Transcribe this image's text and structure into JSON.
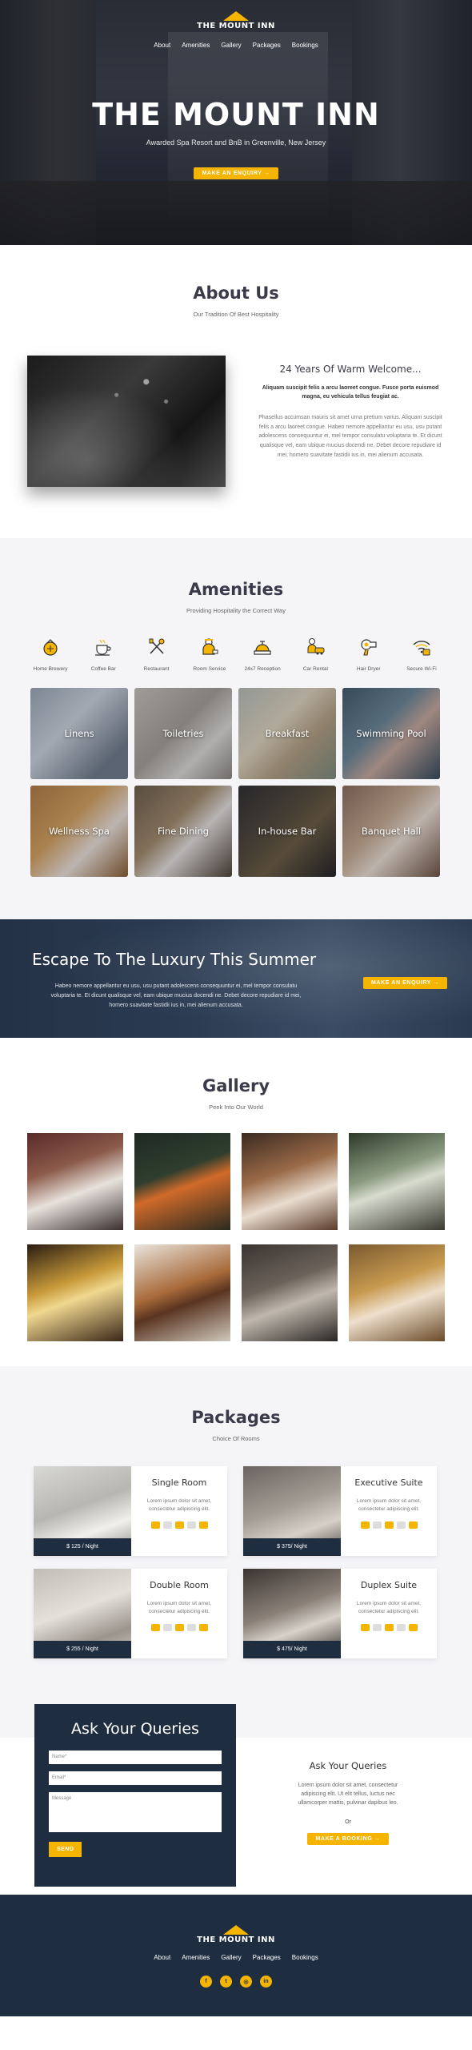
{
  "brand": {
    "name": "THE MOUNT INN"
  },
  "nav": [
    "About",
    "Amenities",
    "Gallery",
    "Packages",
    "Bookings"
  ],
  "hero": {
    "title": "THE MOUNT INN",
    "subtitle": "Awarded Spa Resort and BnB in Greenville, New Jersey",
    "cta": "MAKE AN ENQUIRY →"
  },
  "about": {
    "title": "About Us",
    "subtitle": "Our Tradition Of Best Hospitality",
    "heading": "24 Years Of Warm Welcome...",
    "lead": "Aliquam suscipit felis a arcu laoreet congue. Fusce porta euismod magna, eu vehicula tellus feugiat ac.",
    "body": "Phasellus accumsan mauris sit amet urna pretium varius. Aliquam suscipit felis a arcu laoreet congue. Habeo nemore appellantur eu usu, usu putant adolescens consequuntur ei, mel tempor consulatu voluptaria te. Et dicunt qualisque vel, eam ubique mucius docendi ne. Debet decore repudiare id mei, homero suavitate fastidii ius in, mei alienum accusata."
  },
  "amenities": {
    "title": "Amenities",
    "subtitle": "Providing Hospitality the Correct Way",
    "icons": [
      {
        "label": "Home Brewery",
        "icon": "brewery-icon"
      },
      {
        "label": "Coffee Bar",
        "icon": "coffee-icon"
      },
      {
        "label": "Restaurant",
        "icon": "restaurant-icon"
      },
      {
        "label": "Room Service",
        "icon": "room-service-icon"
      },
      {
        "label": "24x7 Reception",
        "icon": "reception-bell-icon"
      },
      {
        "label": "Car Rental",
        "icon": "car-icon"
      },
      {
        "label": "Hair Dryer",
        "icon": "hair-dryer-icon"
      },
      {
        "label": "Secure Wi-Fi",
        "icon": "wifi-icon"
      }
    ],
    "tiles": [
      "Linens",
      "Toiletries",
      "Breakfast",
      "Swimming Pool",
      "Wellness Spa",
      "Fine Dining",
      "In-house Bar",
      "Banquet Hall"
    ]
  },
  "escape": {
    "title": "Escape To The Luxury This Summer",
    "body": "Habeo nemore appellantur eu usu, usu putant adolescens consequuntur ei, mel tempor consulatu voluptaria te. Et dicunt qualisque vel, eam ubique mucius docendi ne. Debet decore repudiare id mei, homero suavitate fastidii ius in, mei alienum accusata.",
    "cta": "MAKE AN ENQUIRY →"
  },
  "gallery": {
    "title": "Gallery",
    "subtitle": "Peek Into Our World"
  },
  "packages": {
    "title": "Packages",
    "subtitle": "Choice Of Rooms",
    "items": [
      {
        "name": "Single Room",
        "desc": "Lorem ipsum dolor sit amet, consectetur adipiscing elit.",
        "price": "$ 125 / Night"
      },
      {
        "name": "Executive Suite",
        "desc": "Lorem ipsum dolor sit amet, consectetur adipiscing elit.",
        "price": "$ 375/ Night"
      },
      {
        "name": "Double Room",
        "desc": "Lorem ipsum dolor sit amet, consectetur adipiscing elit.",
        "price": "$ 255 / Night"
      },
      {
        "name": "Duplex Suite",
        "desc": "Lorem ipsum dolor sit amet, consectetur adipiscing elit.",
        "price": "$ 475/ Night"
      }
    ]
  },
  "queries": {
    "form_title": "Ask Your Queries",
    "name_placeholder": "Name*",
    "email_placeholder": "Email*",
    "message_placeholder": "Message",
    "send": "SEND",
    "side_title": "Ask Your Queries",
    "side_body": "Lorem ipsum dolor sit amet, consectetur adipiscing elit. Ut elit tellus, luctus nec ullamcorper mattis, pulvinar dapibus leo.",
    "or": "Or",
    "cta": "MAKE A BOOKING →"
  },
  "socials": [
    {
      "icon": "facebook-icon",
      "glyph": "f"
    },
    {
      "icon": "twitter-icon",
      "glyph": "t"
    },
    {
      "icon": "instagram-icon",
      "glyph": "◎"
    },
    {
      "icon": "linkedin-icon",
      "glyph": "in"
    }
  ],
  "colors": {
    "accent": "#f5b400",
    "navy": "#1f2d40",
    "light": "#f5f5f8"
  }
}
